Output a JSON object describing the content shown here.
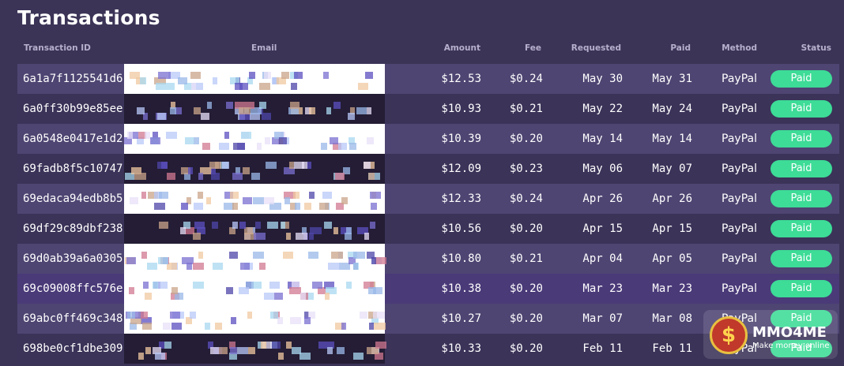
{
  "page": {
    "title": "Transactions"
  },
  "columns": {
    "transaction_id": "Transaction ID",
    "email": "Email",
    "amount": "Amount",
    "fee": "Fee",
    "requested": "Requested",
    "paid": "Paid",
    "method": "Method",
    "status": "Status"
  },
  "rows": [
    {
      "id": "6a1a7f1125541d6",
      "amount": "$12.53",
      "fee": "$0.24",
      "requested": "May 30",
      "paid": "May 31",
      "method": "PayPal",
      "status": "Paid"
    },
    {
      "id": "6a0ff30b99e85ee",
      "amount": "$10.93",
      "fee": "$0.21",
      "requested": "May 22",
      "paid": "May 24",
      "method": "PayPal",
      "status": "Paid"
    },
    {
      "id": "6a0548e0417e1d2",
      "amount": "$10.39",
      "fee": "$0.20",
      "requested": "May 14",
      "paid": "May 14",
      "method": "PayPal",
      "status": "Paid"
    },
    {
      "id": "69fadb8f5c10747",
      "amount": "$12.09",
      "fee": "$0.23",
      "requested": "May 06",
      "paid": "May 07",
      "method": "PayPal",
      "status": "Paid"
    },
    {
      "id": "69edaca94edb8b5",
      "amount": "$12.33",
      "fee": "$0.24",
      "requested": "Apr 26",
      "paid": "Apr 26",
      "method": "PayPal",
      "status": "Paid"
    },
    {
      "id": "69df29c89dbf238",
      "amount": "$10.56",
      "fee": "$0.20",
      "requested": "Apr 15",
      "paid": "Apr 15",
      "method": "PayPal",
      "status": "Paid"
    },
    {
      "id": "69d0ab39a6a0305",
      "amount": "$10.80",
      "fee": "$0.21",
      "requested": "Apr 04",
      "paid": "Apr 05",
      "method": "PayPal",
      "status": "Paid"
    },
    {
      "id": "69c09008ffc576e",
      "amount": "$10.38",
      "fee": "$0.20",
      "requested": "Mar 23",
      "paid": "Mar 23",
      "method": "PayPal",
      "status": "Paid"
    },
    {
      "id": "69abc0ff469c348",
      "amount": "$10.27",
      "fee": "$0.20",
      "requested": "Mar 07",
      "paid": "Mar 08",
      "method": "PayPal",
      "status": "Paid"
    },
    {
      "id": "698be0cf1dbe309",
      "amount": "$10.33",
      "fee": "$0.20",
      "requested": "Feb 11",
      "paid": "Feb 11",
      "method": "PayPal",
      "status": "Paid"
    }
  ],
  "watermark": {
    "name": "MMO4ME",
    "tagline": "Make money online",
    "icon": "dollar-coin-logo"
  },
  "colors": {
    "background": "#3c3457",
    "row_odd": "#4e4572",
    "row_even": "#3b3358",
    "status_paid": "#3ddc97"
  }
}
